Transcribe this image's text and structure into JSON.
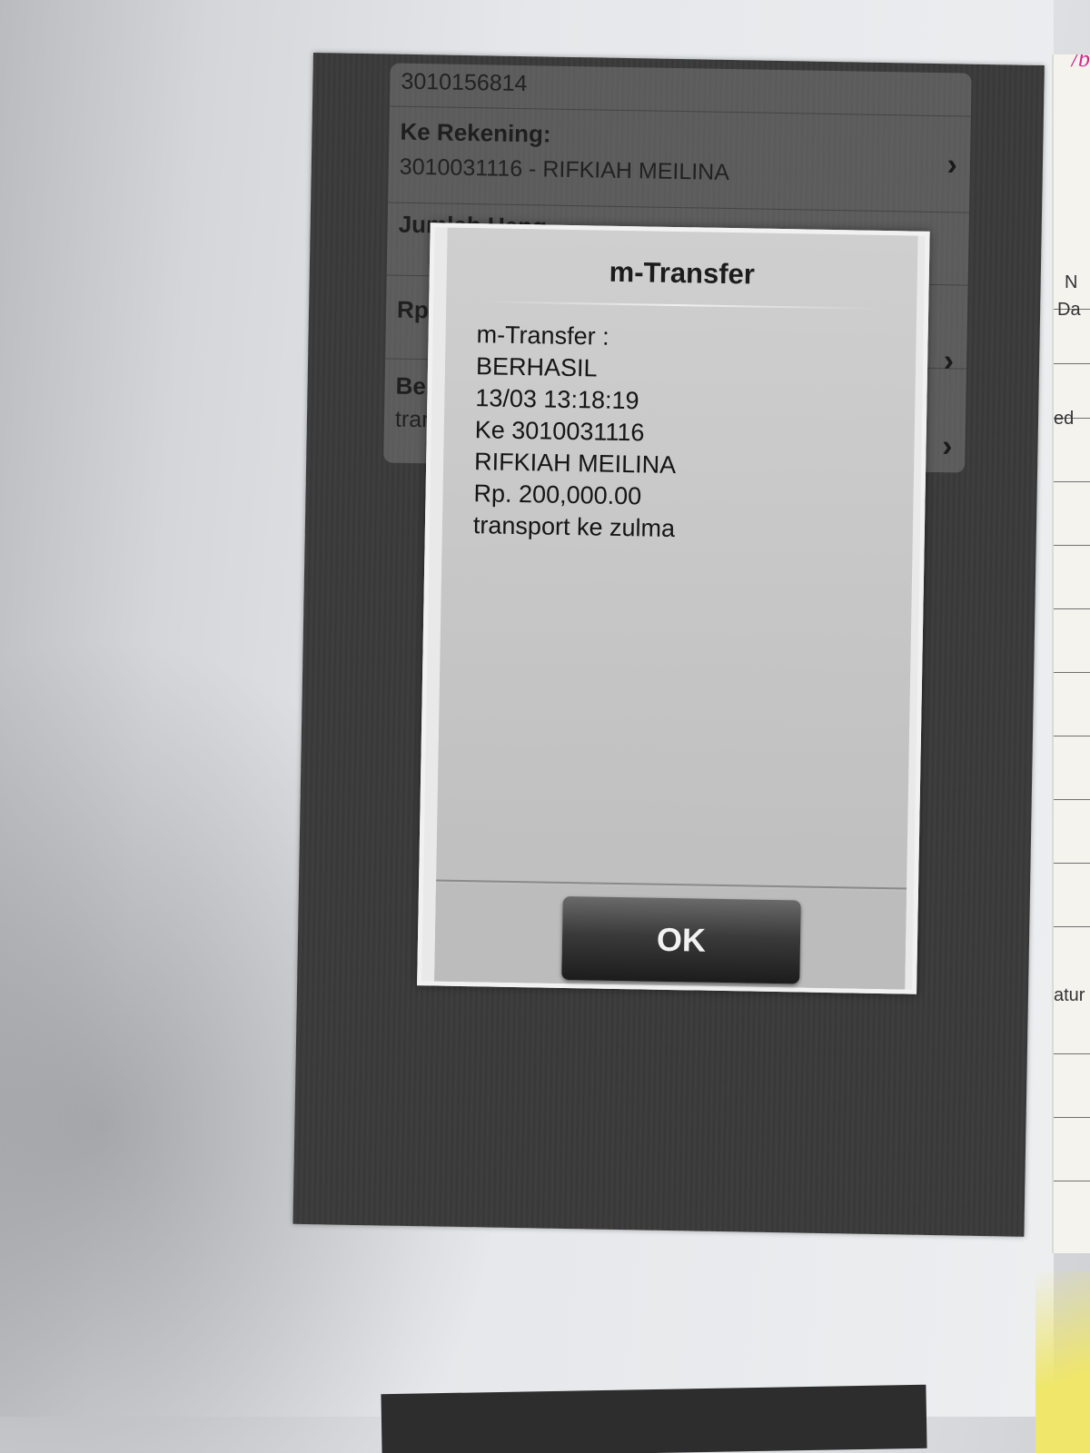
{
  "background_screen": {
    "from_account_number": "3010156814",
    "to_account_label": "Ke Rekening:",
    "to_account_value": "3010031116 - RIFKIAH MEILINA",
    "amount_label": "Jumlah Uang",
    "amount_prefix": "Rp",
    "news_label": "Ber",
    "news_value": "tran"
  },
  "dialog": {
    "title": "m-Transfer",
    "lines": [
      "m-Transfer :",
      "BERHASIL",
      "13/03 13:18:19",
      "Ke 3010031116",
      "RIFKIAH MEILINA",
      "Rp. 200,000.00",
      "transport ke zulma"
    ],
    "ok_label": "OK"
  },
  "side_notebook": {
    "fragments": [
      "N",
      "Da",
      "ed",
      "atur"
    ],
    "handwriting": "/b"
  },
  "colors": {
    "phone_background": "#3a3a3a",
    "dialog_background": "#c8c8c8",
    "ok_button": "#2a2a2a",
    "handwriting_pink": "#d02a8c"
  }
}
